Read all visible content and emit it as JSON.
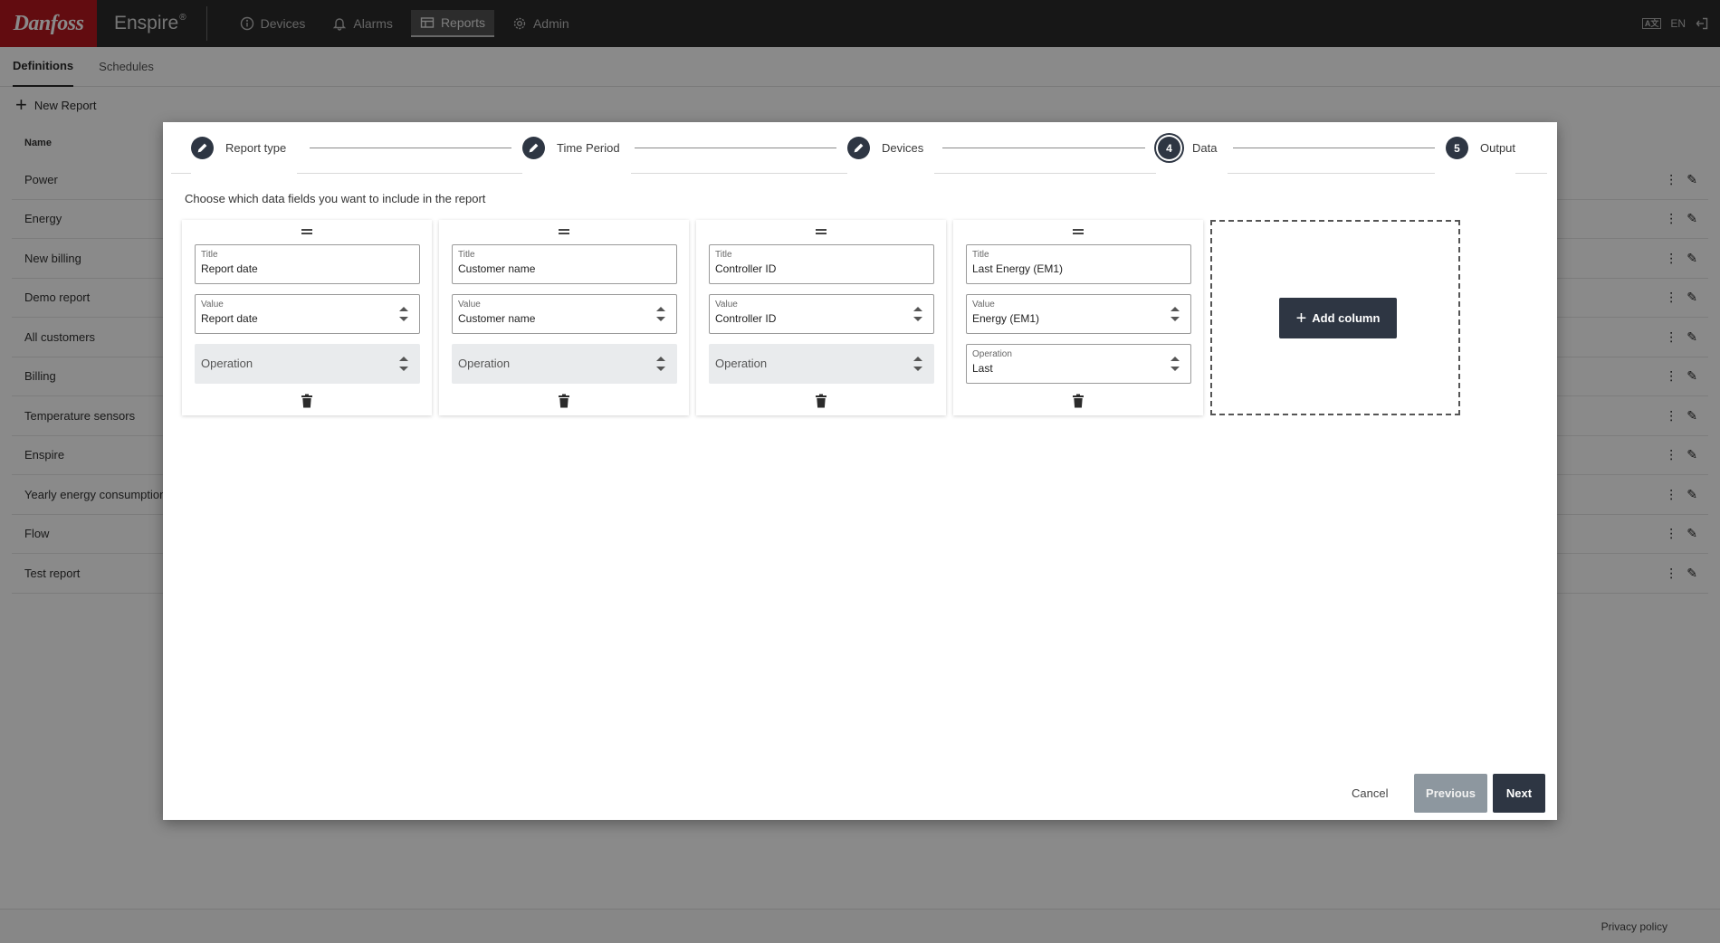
{
  "brand": {
    "logo_text": "Danfoss",
    "app_name": "Enspire",
    "app_mark": "®"
  },
  "nav": [
    {
      "label": "Devices",
      "icon": "info-icon"
    },
    {
      "label": "Alarms",
      "icon": "bell-icon"
    },
    {
      "label": "Reports",
      "icon": "table-icon"
    },
    {
      "label": "Admin",
      "icon": "gear-icon"
    }
  ],
  "top_right": {
    "language": "EN",
    "lang_icon_text": "A文"
  },
  "subtabs": [
    "Definitions",
    "Schedules"
  ],
  "new_report_label": "New Report",
  "list": {
    "header": "Name",
    "rows": [
      "Power",
      "Energy",
      "New billing",
      "Demo report",
      "All customers",
      "Billing",
      "Temperature sensors",
      "Enspire",
      "Yearly energy consumption",
      "Flow",
      "Test report"
    ]
  },
  "footer": {
    "privacy": "Privacy policy"
  },
  "modal": {
    "steps": [
      {
        "label": "Report type",
        "state": "done"
      },
      {
        "label": "Time Period",
        "state": "done"
      },
      {
        "label": "Devices",
        "state": "done"
      },
      {
        "label": "Data",
        "number": "4",
        "state": "current"
      },
      {
        "label": "Output",
        "number": "5",
        "state": "todo"
      }
    ],
    "instruction": "Choose which data fields you want to include in the report",
    "columns": [
      {
        "title_label": "Title",
        "title": "Report date",
        "value_label": "Value",
        "value": "Report date",
        "operation_label": "Operation",
        "operation": ""
      },
      {
        "title_label": "Title",
        "title": "Customer name",
        "value_label": "Value",
        "value": "Customer name",
        "operation_label": "Operation",
        "operation": ""
      },
      {
        "title_label": "Title",
        "title": "Controller ID",
        "value_label": "Value",
        "value": "Controller ID",
        "operation_label": "Operation",
        "operation": ""
      },
      {
        "title_label": "Title",
        "title": "Last Energy (EM1)",
        "value_label": "Value",
        "value": "Energy (EM1)",
        "operation_label": "Operation",
        "operation": "Last"
      }
    ],
    "add_column_label": "Add column",
    "buttons": {
      "cancel": "Cancel",
      "previous": "Previous",
      "next": "Next"
    }
  },
  "colors": {
    "brand_red": "#b5171e",
    "topbar": "#2b2b2b",
    "primary": "#2e3643",
    "disabled_button": "#8d979f"
  }
}
